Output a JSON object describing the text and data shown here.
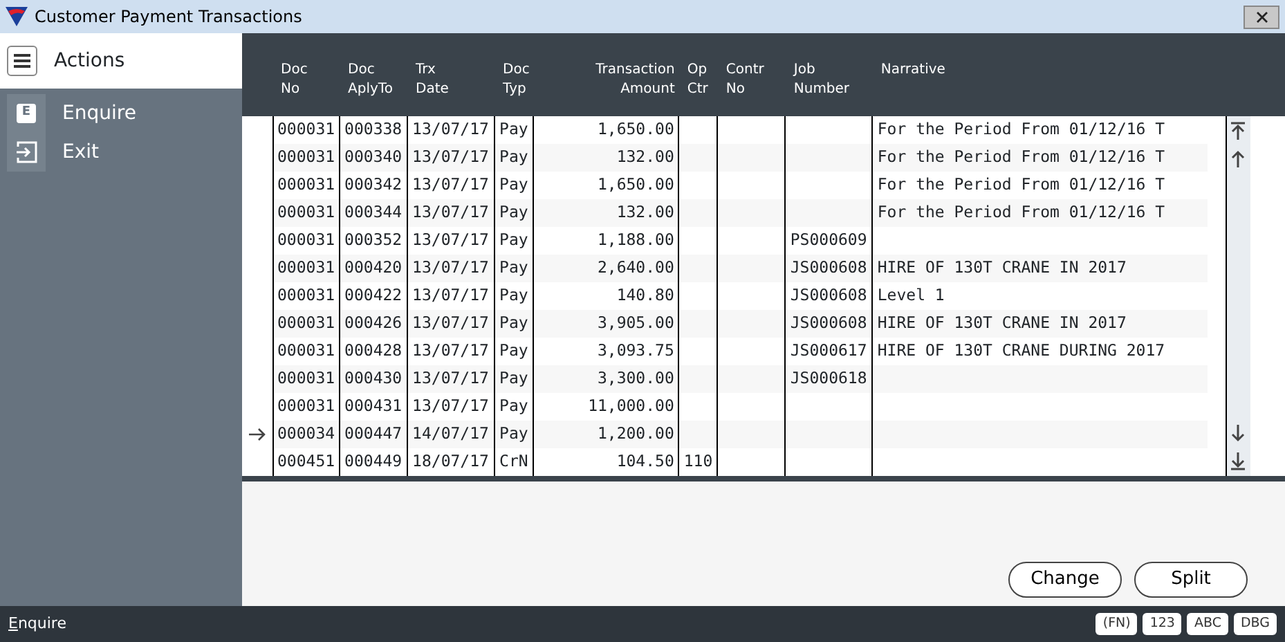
{
  "window": {
    "title": "Customer Payment Transactions"
  },
  "sidebar": {
    "title": "Actions",
    "items": [
      {
        "key": "E",
        "label": "Enquire",
        "kind": "key"
      },
      {
        "label": "Exit",
        "kind": "exit"
      }
    ]
  },
  "table": {
    "columns": [
      {
        "label": "Doc\nNo"
      },
      {
        "label": "Doc\nAplyTo"
      },
      {
        "label": "Trx\nDate"
      },
      {
        "label": "Doc\nTyp"
      },
      {
        "label": "Transaction\nAmount"
      },
      {
        "label": "Op\nCtr"
      },
      {
        "label": "Contr\nNo"
      },
      {
        "label": "Job\nNumber"
      },
      {
        "label": "Narrative"
      }
    ],
    "rows": [
      {
        "current": false,
        "cells": [
          "000031",
          "000338",
          "13/07/17",
          "Pay",
          "1,650.00",
          "",
          "",
          "",
          "For the Period From 01/12/16 T"
        ]
      },
      {
        "current": false,
        "cells": [
          "000031",
          "000340",
          "13/07/17",
          "Pay",
          "132.00",
          "",
          "",
          "",
          "For the Period From 01/12/16 T"
        ]
      },
      {
        "current": false,
        "cells": [
          "000031",
          "000342",
          "13/07/17",
          "Pay",
          "1,650.00",
          "",
          "",
          "",
          "For the Period From 01/12/16 T"
        ]
      },
      {
        "current": false,
        "cells": [
          "000031",
          "000344",
          "13/07/17",
          "Pay",
          "132.00",
          "",
          "",
          "",
          "For the Period From 01/12/16 T"
        ]
      },
      {
        "current": false,
        "cells": [
          "000031",
          "000352",
          "13/07/17",
          "Pay",
          "1,188.00",
          "",
          "",
          "PS000609",
          ""
        ]
      },
      {
        "current": false,
        "cells": [
          "000031",
          "000420",
          "13/07/17",
          "Pay",
          "2,640.00",
          "",
          "",
          "JS000608",
          "HIRE OF 130T CRANE IN 2017"
        ]
      },
      {
        "current": false,
        "cells": [
          "000031",
          "000422",
          "13/07/17",
          "Pay",
          "140.80",
          "",
          "",
          "JS000608",
          "Level 1"
        ]
      },
      {
        "current": false,
        "cells": [
          "000031",
          "000426",
          "13/07/17",
          "Pay",
          "3,905.00",
          "",
          "",
          "JS000608",
          "HIRE OF 130T CRANE IN 2017"
        ]
      },
      {
        "current": false,
        "cells": [
          "000031",
          "000428",
          "13/07/17",
          "Pay",
          "3,093.75",
          "",
          "",
          "JS000617",
          "HIRE OF 130T CRANE DURING 2017"
        ]
      },
      {
        "current": false,
        "cells": [
          "000031",
          "000430",
          "13/07/17",
          "Pay",
          "3,300.00",
          "",
          "",
          "JS000618",
          ""
        ]
      },
      {
        "current": false,
        "cells": [
          "000031",
          "000431",
          "13/07/17",
          "Pay",
          "11,000.00",
          "",
          "",
          "",
          ""
        ]
      },
      {
        "current": true,
        "cells": [
          "000034",
          "000447",
          "14/07/17",
          "Pay",
          "1,200.00",
          "",
          "",
          "",
          ""
        ]
      },
      {
        "current": false,
        "cells": [
          "000451",
          "000449",
          "18/07/17",
          "CrN",
          "104.50",
          "110",
          "",
          "",
          ""
        ]
      }
    ]
  },
  "buttons": [
    "Change",
    "Split"
  ],
  "status_bar": {
    "mode": "Enquire",
    "indicators": [
      "(FN)",
      "123",
      "ABC",
      "DBG"
    ]
  }
}
